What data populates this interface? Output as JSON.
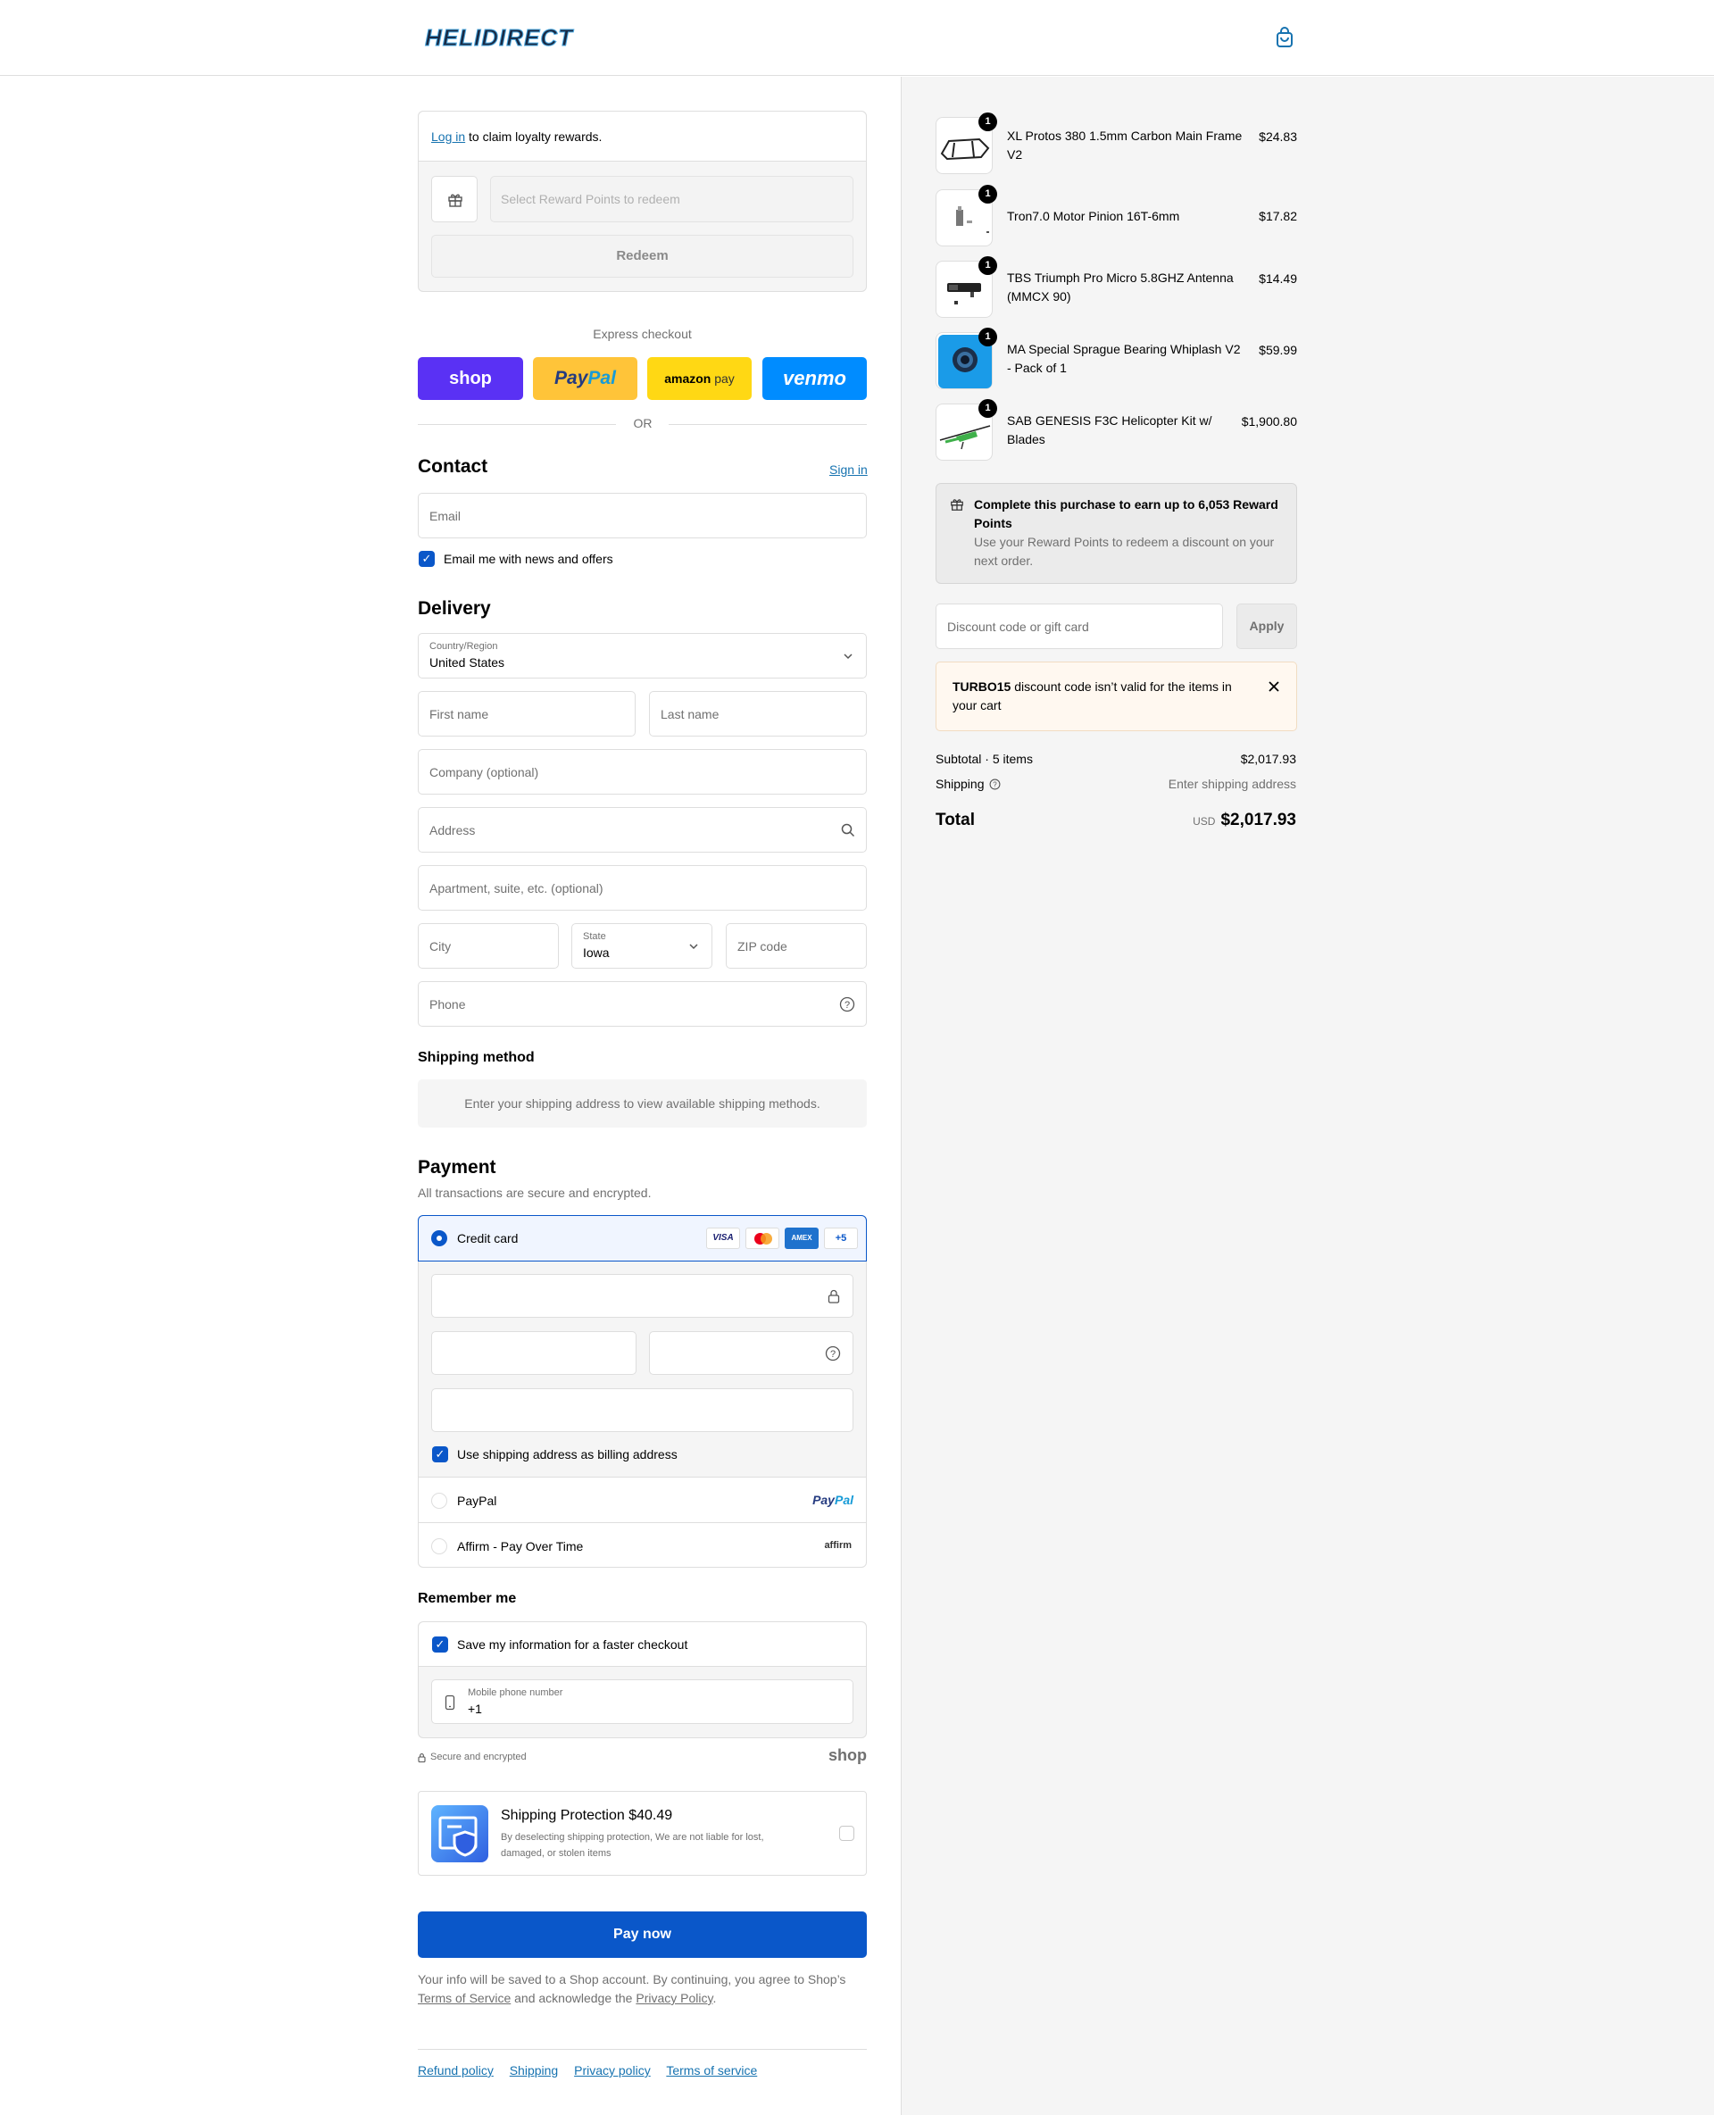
{
  "header": {
    "logo_text": "HELIDIRECT",
    "cart_icon": "bag-icon"
  },
  "loyalty": {
    "login_link": "Log in",
    "login_suffix": " to claim loyalty rewards.",
    "select_placeholder": "Select Reward Points to redeem",
    "redeem_label": "Redeem"
  },
  "express": {
    "title": "Express checkout",
    "shop": "shop",
    "paypal_1": "Pay",
    "paypal_2": "Pal",
    "amazon_1": "amazon",
    "amazon_2": " pay",
    "venmo": "venmo",
    "or": "OR"
  },
  "contact": {
    "title": "Contact",
    "sign_in": "Sign in",
    "email_placeholder": "Email",
    "news_label": "Email me with news and offers"
  },
  "delivery": {
    "title": "Delivery",
    "country_label": "Country/Region",
    "country_value": "United States",
    "first_name": "First name",
    "last_name": "Last name",
    "company": "Company (optional)",
    "address": "Address",
    "apartment": "Apartment, suite, etc. (optional)",
    "city": "City",
    "state_label": "State",
    "state_value": "Iowa",
    "zip": "ZIP code",
    "phone": "Phone"
  },
  "shipping_method": {
    "title": "Shipping method",
    "message": "Enter your shipping address to view available shipping methods."
  },
  "payment": {
    "title": "Payment",
    "subtitle": "All transactions are secure and encrypted.",
    "credit_card": "Credit card",
    "visa": "VISA",
    "amex": "AMEX",
    "more": "+5",
    "billing_label": "Use shipping address as billing address",
    "paypal": "PayPal",
    "paypal_logo_1": "Pay",
    "paypal_logo_2": "Pal",
    "affirm": "Affirm - Pay Over Time",
    "affirm_logo": "affirm"
  },
  "remember": {
    "title": "Remember me",
    "save_label": "Save my information for a faster checkout",
    "mobile_label": "Mobile phone number",
    "mobile_value": "+1",
    "secure": "Secure and encrypted",
    "shop": "shop"
  },
  "protection": {
    "title": "Shipping Protection $40.49",
    "desc": "By deselecting shipping protection, We are not liable for lost, damaged, or stolen items"
  },
  "pay_now": "Pay now",
  "legal": {
    "text_1": "Your info will be saved to a Shop account. By continuing, you agree to Shop’s ",
    "tos": "Terms of Service",
    "text_2": " and acknowledge the ",
    "privacy": "Privacy Policy",
    "text_3": "."
  },
  "footer_links": [
    "Refund policy",
    "Shipping",
    "Privacy policy",
    "Terms of service"
  ],
  "cart": {
    "items": [
      {
        "name": "XL Protos 380 1.5mm Carbon Main Frame V2",
        "price": "$24.83",
        "qty": "1"
      },
      {
        "name": "Tron7.0 Motor Pinion 16T-6mm",
        "price": "$17.82",
        "qty": "1"
      },
      {
        "name": "TBS Triumph Pro Micro 5.8GHZ Antenna (MMCX 90)",
        "price": "$14.49",
        "qty": "1"
      },
      {
        "name": "MA Special Sprague Bearing Whiplash V2 - Pack of 1",
        "price": "$59.99",
        "qty": "1"
      },
      {
        "name": "SAB GENESIS F3C Helicopter Kit w/ Blades",
        "price": "$1,900.80",
        "qty": "1"
      }
    ],
    "reward_title": "Complete this purchase to earn up to 6,053 Reward Points",
    "reward_desc": "Use your Reward Points to redeem a discount on your next order.",
    "discount_placeholder": "Discount code or gift card",
    "apply": "Apply",
    "error_code": "TURBO15",
    "error_text": " discount code isn’t valid for the items in your cart",
    "subtotal_label": "Subtotal · 5 items",
    "subtotal_value": "$2,017.93",
    "shipping_label": "Shipping",
    "shipping_value": "Enter shipping address",
    "total_label": "Total",
    "total_currency": "USD",
    "total_value": "$2,017.93"
  },
  "colors": {
    "accent": "#0a57c9",
    "link": "#1773b0",
    "shop": "#5a31f4",
    "paypal_bg": "#ffc439",
    "amazon_bg": "#ffd814",
    "venmo_bg": "#008cff",
    "error_bg": "#fff8f0"
  }
}
